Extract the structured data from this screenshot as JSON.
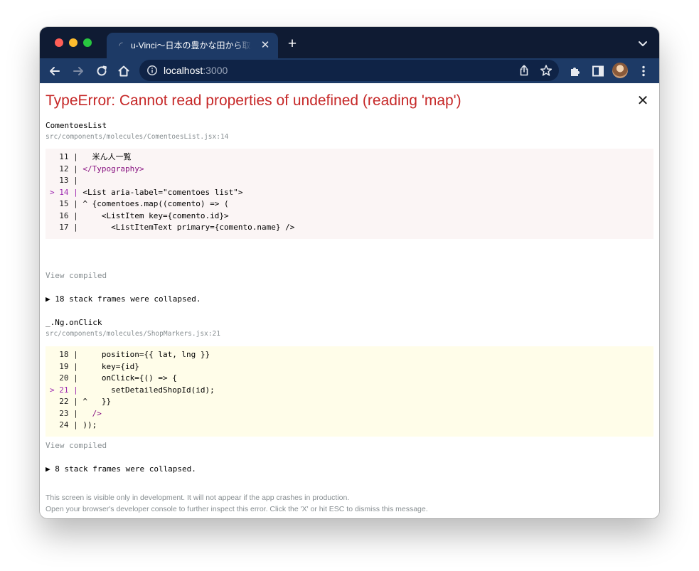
{
  "browser": {
    "tab": {
      "title": "u-Vinci〜日本の豊かな田から取れる",
      "favicon": "loading-spinner-icon"
    },
    "address": {
      "host": "localhost",
      "port": ":3000"
    }
  },
  "error": {
    "title": "TypeError: Cannot read properties of undefined (reading 'map')",
    "dismiss_label": "✕"
  },
  "frames": [
    {
      "name": "ComentoesList",
      "file": "src/components/molecules/ComentoesList.jsx:14",
      "lines": [
        {
          "gutter": "  11 | ",
          "code": "  米ん人一覧"
        },
        {
          "gutter": "  12 | ",
          "code": "</Typography>"
        },
        {
          "gutter": "  13 | ",
          "code": ""
        },
        {
          "gutter": "> 14 | ",
          "code": "<List aria-label=\"comentoes list\">"
        },
        {
          "gutter": "  15 | ",
          "code": "^ {comentoes.map((comento) => ("
        },
        {
          "gutter": "  16 | ",
          "code": "    <ListItem key={comento.id}>"
        },
        {
          "gutter": "  17 | ",
          "code": "      <ListItemText primary={comento.name} />"
        }
      ],
      "view_compiled": "View compiled",
      "collapsed": "▶ 18 stack frames were collapsed."
    },
    {
      "name": "_.Ng.onClick",
      "file": "src/components/molecules/ShopMarkers.jsx:21",
      "lines": [
        {
          "gutter": "  18 | ",
          "code": "    position={{ lat, lng }}"
        },
        {
          "gutter": "  19 | ",
          "code": "    key={id}"
        },
        {
          "gutter": "  20 | ",
          "code": "    onClick={() => {"
        },
        {
          "gutter": "> 21 | ",
          "code": "      setDetailedShopId(id);"
        },
        {
          "gutter": "  22 | ",
          "code": "^   }}"
        },
        {
          "gutter": "  23 | ",
          "code": "  />"
        },
        {
          "gutter": "  24 | ",
          "code": "));"
        }
      ],
      "view_compiled": "View compiled",
      "collapsed": "▶ 8 stack frames were collapsed."
    }
  ],
  "footer": {
    "line1": "This screen is visible only in development. It will not appear if the app crashes in production.",
    "line2": "Open your browser's developer console to further inspect this error.  Click the 'X' or hit ESC to dismiss this message."
  },
  "colors": {
    "error_red": "#c62828",
    "source_frame_bg": "#fbf5f5",
    "compiled_frame_bg": "#fffde9",
    "tab_strip": "#0f1b33",
    "toolbar": "#1d3a66"
  }
}
